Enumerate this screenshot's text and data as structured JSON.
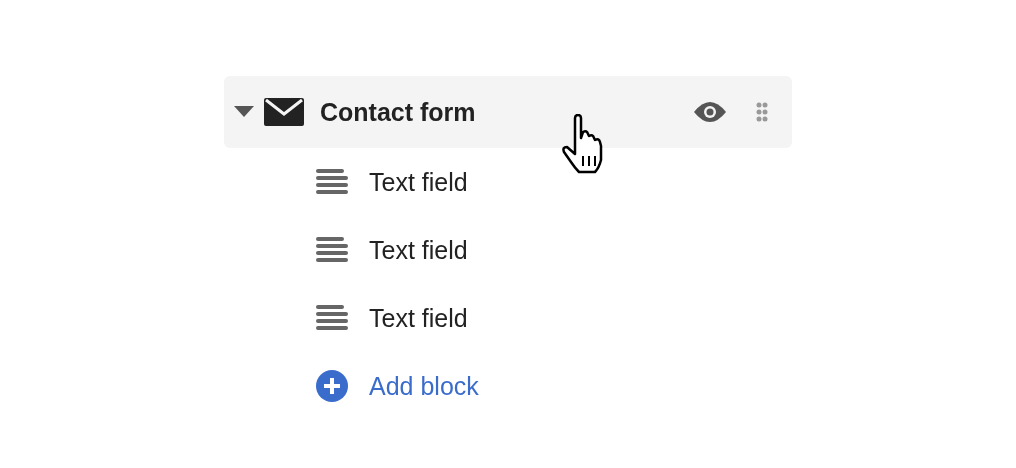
{
  "section": {
    "title": "Contact form",
    "expanded": true,
    "children": [
      {
        "kind": "text",
        "label": "Text field"
      },
      {
        "kind": "text",
        "label": "Text field"
      },
      {
        "kind": "text",
        "label": "Text field"
      },
      {
        "kind": "add",
        "label": "Add block"
      }
    ]
  }
}
